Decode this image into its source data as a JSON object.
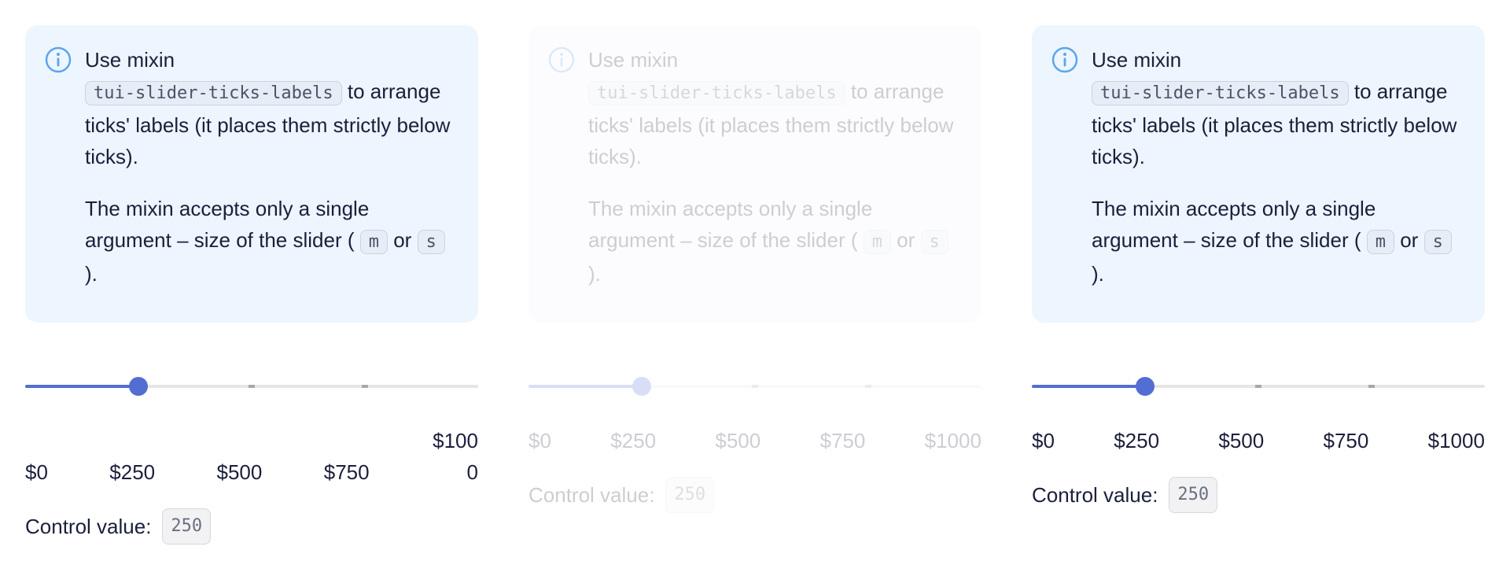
{
  "notice": {
    "line1": "Use mixin",
    "mixin_code": "tui-slider-ticks-labels",
    "line1_cont": "to arrange ticks' labels (it places them strictly below ticks).",
    "para2_start": "The mixin accepts only a single argument – size of the slider (",
    "size_m": "m",
    "or_word": "or",
    "size_s": "s",
    "para2_end": ")."
  },
  "slider": {
    "min": 0,
    "max": 1000,
    "value": 250,
    "steps": 4,
    "labels": [
      "$0",
      "$250",
      "$500",
      "$750",
      "$1000"
    ]
  },
  "control": {
    "label": "Control value:",
    "value": "250"
  },
  "colors": {
    "accent": "#526ed3",
    "notice_bg": "#edf5fe",
    "info_icon": "#5aa5f0"
  },
  "icons": {
    "notice": "info-circle-icon"
  }
}
